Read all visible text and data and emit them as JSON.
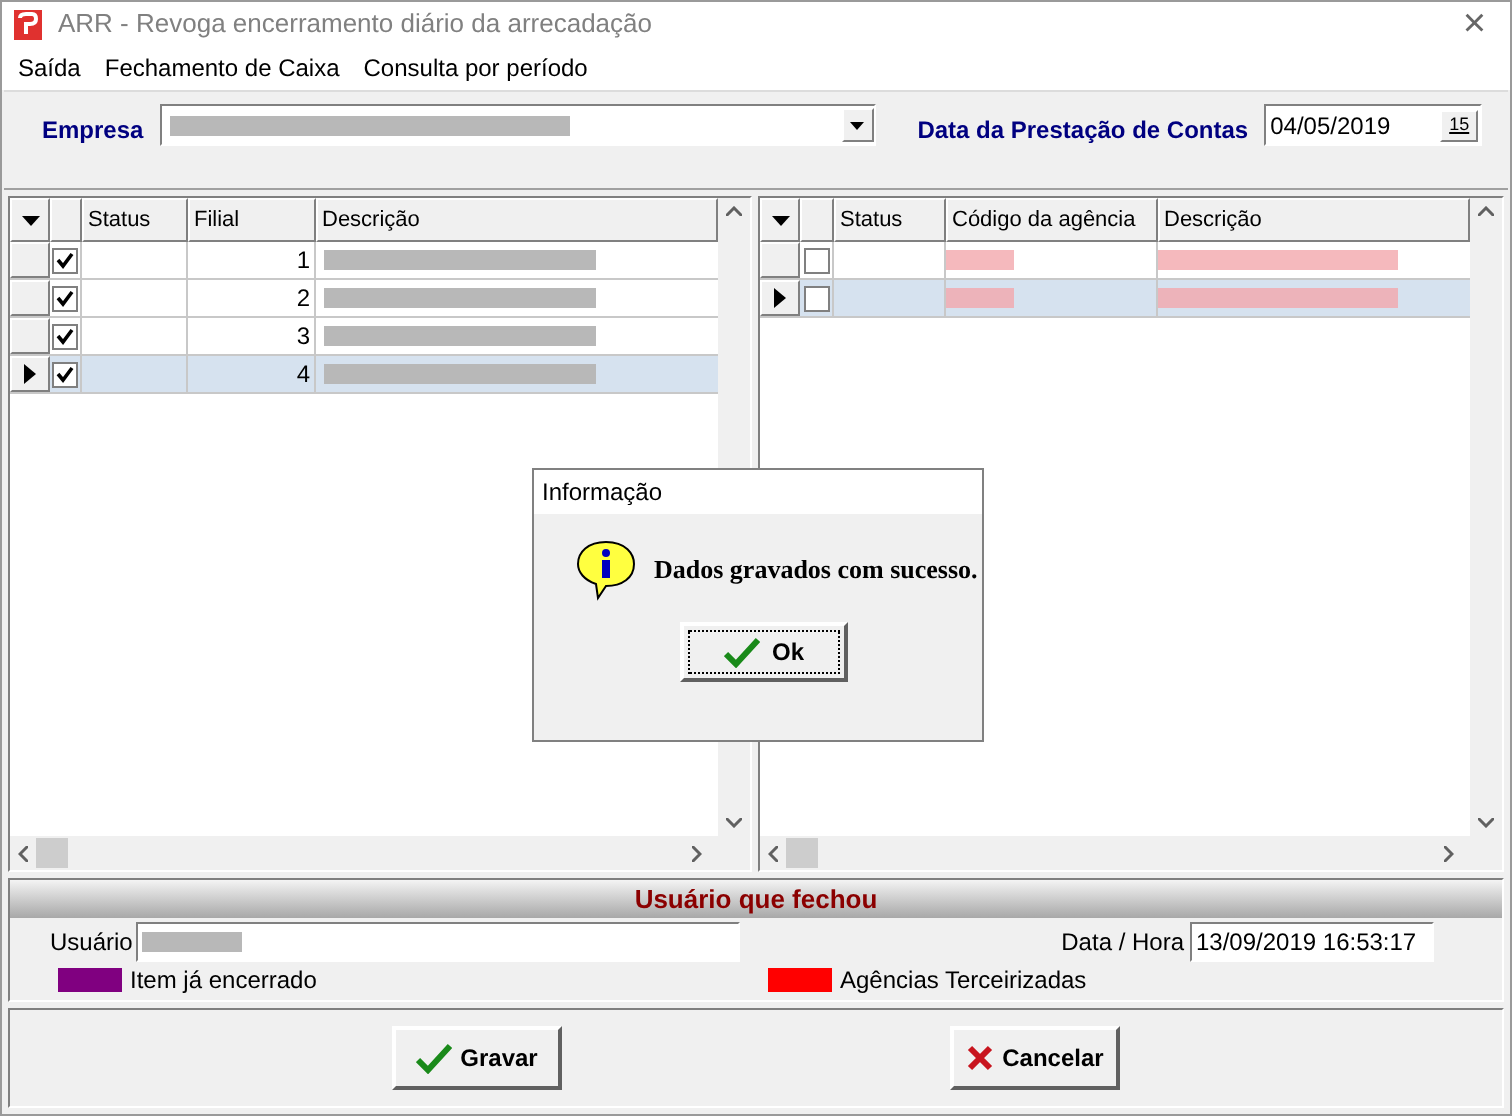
{
  "window": {
    "title": "ARR - Revoga encerramento diário da arrecadação",
    "close": "×"
  },
  "menu": [
    "Saída",
    "Fechamento de Caixa",
    "Consulta por período"
  ],
  "empresa": {
    "label": "Empresa"
  },
  "data_prestacao": {
    "label": "Data da Prestação de Contas",
    "value": "04/05/2019",
    "calendar": "15"
  },
  "left_grid": {
    "columns": [
      "Status",
      "Filial",
      "Descrição"
    ],
    "rows": [
      {
        "checked": true,
        "selected": false,
        "filial": "1"
      },
      {
        "checked": true,
        "selected": false,
        "filial": "2"
      },
      {
        "checked": true,
        "selected": false,
        "filial": "3"
      },
      {
        "checked": true,
        "selected": true,
        "filial": "4"
      }
    ]
  },
  "right_grid": {
    "columns": [
      "Status",
      "Código da agência",
      "Descrição"
    ],
    "rows": [
      {
        "checked": false,
        "selected": false
      },
      {
        "checked": false,
        "selected": true
      }
    ]
  },
  "dialog": {
    "title": "Informação",
    "message": "Dados gravados com sucesso.",
    "button": "Ok"
  },
  "section": {
    "title": "Usuário que fechou",
    "user_label": "Usuário",
    "datetime_label": "Data / Hora",
    "datetime": "13/09/2019 16:53:17"
  },
  "legend": [
    {
      "color": "#800080",
      "label": "Item já encerrado"
    },
    {
      "color": "#ff0000",
      "label": "Agências Terceirizadas"
    }
  ],
  "buttons": [
    {
      "kind": "save",
      "label": "Gravar"
    },
    {
      "kind": "cancel",
      "label": "Cancelar"
    }
  ]
}
